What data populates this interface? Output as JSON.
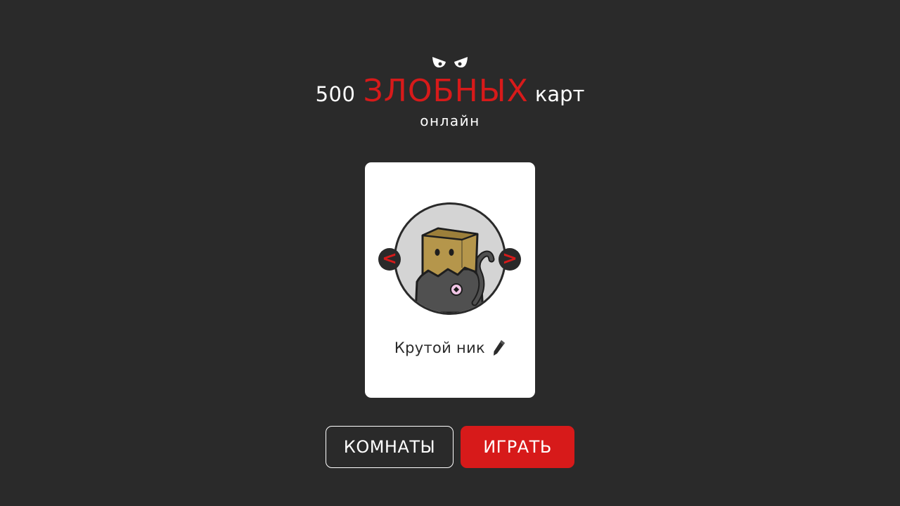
{
  "logo": {
    "prefix": "500",
    "main": "ЗЛОБНЫХ",
    "suffix": "карт",
    "subtitle": "онлайн"
  },
  "profile": {
    "nickname": "Крутой ник",
    "prev_label": "<",
    "next_label": ">",
    "avatar_icon": "paper-bag-cat-icon",
    "edit_icon": "pencil-icon"
  },
  "actions": {
    "rooms_label": "КОМНАТЫ",
    "play_label": "ИГРАТЬ"
  },
  "colors": {
    "background": "#2a2a2a",
    "accent": "#d71a1a",
    "card": "#ffffff"
  }
}
